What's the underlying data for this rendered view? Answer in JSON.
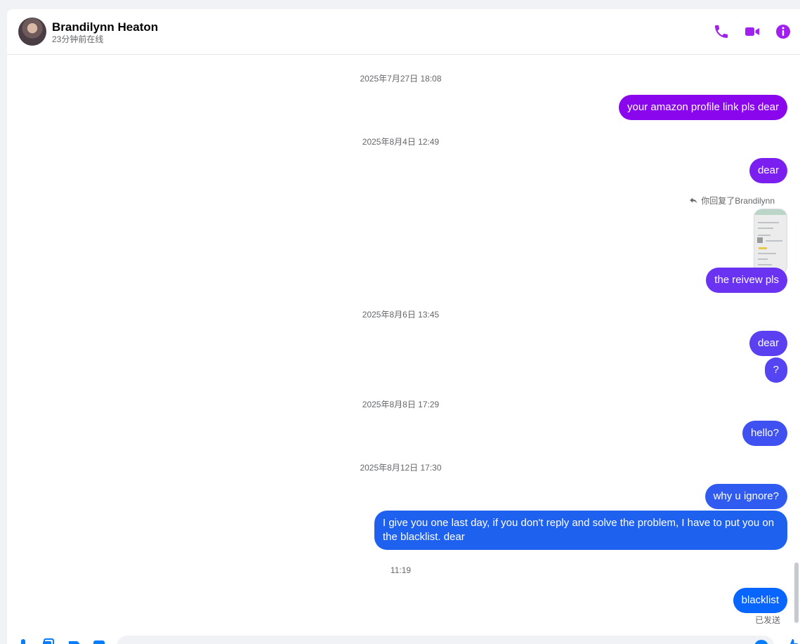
{
  "header": {
    "contact_name": "Brandilynn Heaton",
    "status": "23分钟前在线",
    "icons": [
      "phone-icon",
      "video-camera-icon",
      "info-icon"
    ]
  },
  "messages": [
    {
      "type": "timestamp",
      "text": "2025年7月27日 18:08"
    },
    {
      "type": "sent",
      "text": "your amazon profile link pls dear",
      "color": "#8a06ec"
    },
    {
      "type": "timestamp",
      "text": "2025年8月4日 12:49"
    },
    {
      "type": "sent",
      "text": "dear",
      "color": "#7a1ff0"
    },
    {
      "type": "reply",
      "text": "你回复了Brandilynn"
    },
    {
      "type": "sent",
      "text": "the reivew pls",
      "color": "#6a33f1"
    },
    {
      "type": "timestamp",
      "text": "2025年8月6日 13:45"
    },
    {
      "type": "sent",
      "text": "dear",
      "color": "#5b40f2"
    },
    {
      "type": "sent",
      "text": "?",
      "color": "#5444f2"
    },
    {
      "type": "timestamp",
      "text": "2025年8月8日 17:29"
    },
    {
      "type": "sent",
      "text": "hello?",
      "color": "#3f52f1"
    },
    {
      "type": "timestamp",
      "text": "2025年8月12日 17:30"
    },
    {
      "type": "sent",
      "text": "why u ignore?",
      "color": "#2f5bf0"
    },
    {
      "type": "sent",
      "text": "I give you one last day, if you don't reply and solve the problem, I have to put you on the blacklist. dear",
      "color": "#1f61ef"
    },
    {
      "type": "timestamp",
      "text": "11:19"
    },
    {
      "type": "sent",
      "text": "blacklist",
      "color": "#0866ff"
    }
  ],
  "sent_status": "已发送",
  "composer": {
    "placeholder": "",
    "icons": [
      "microphone-icon",
      "gallery-icon",
      "sticker-icon",
      "gif-icon",
      "emoji-icon",
      "like-icon"
    ]
  },
  "colors": {
    "accent": "#a020f0",
    "composer_accent": "#0a7cff"
  }
}
